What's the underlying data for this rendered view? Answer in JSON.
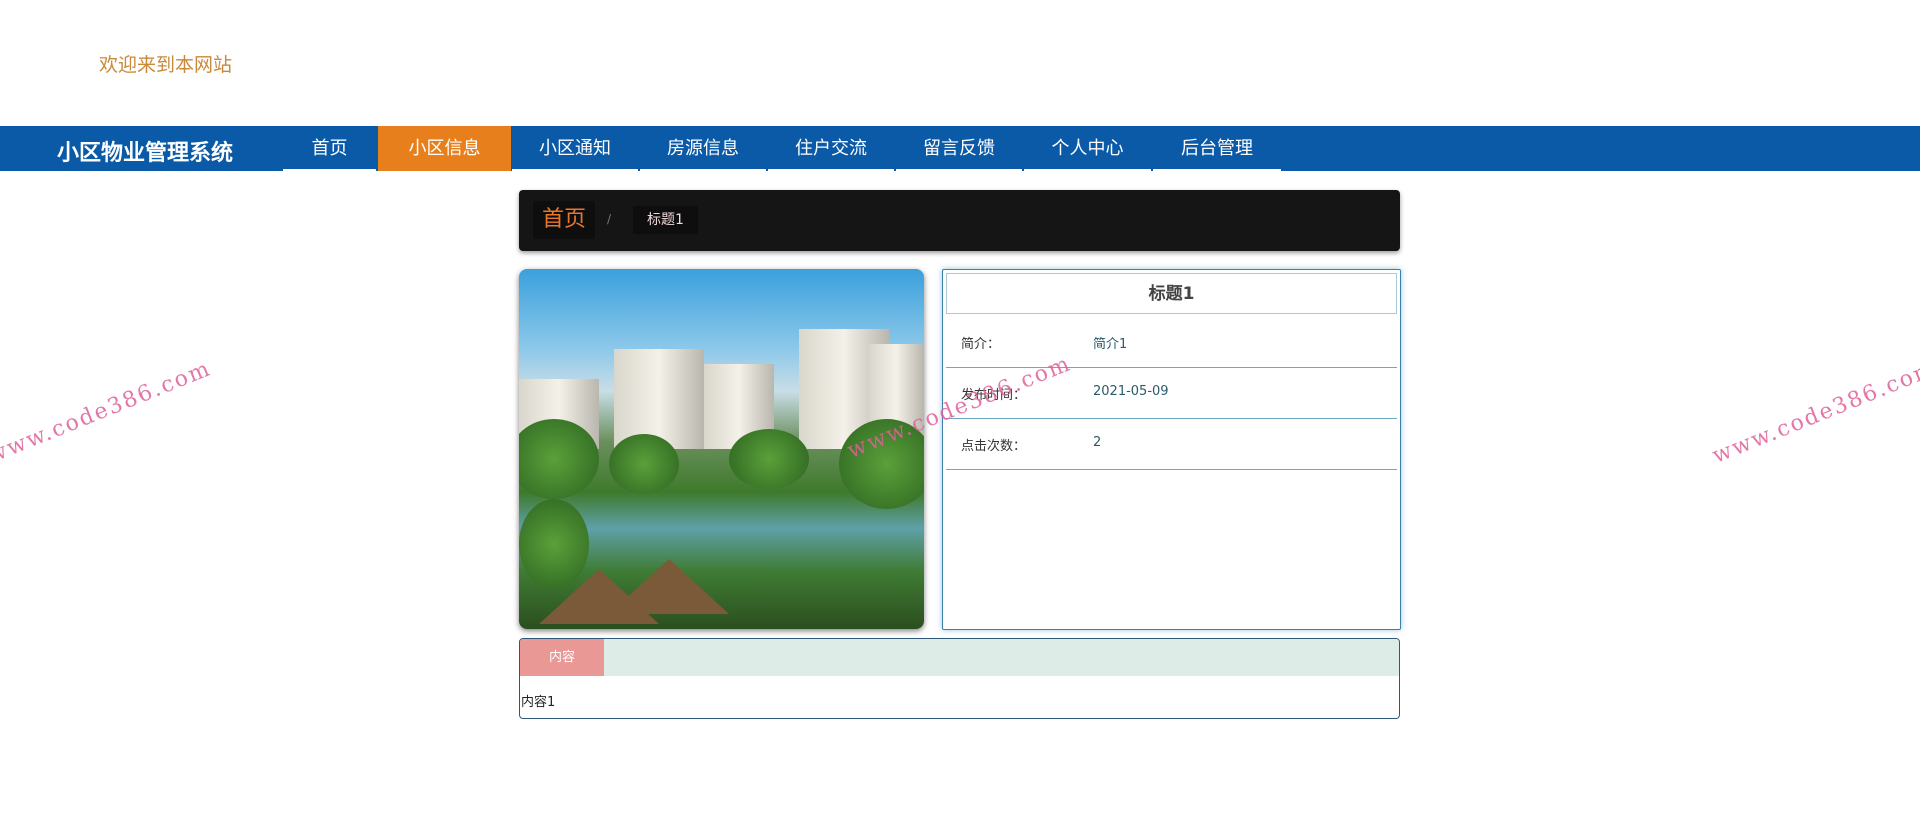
{
  "welcome": "欢迎来到本网站",
  "nav": {
    "brand": "小区物业管理系统",
    "items": [
      "首页",
      "小区信息",
      "小区通知",
      "房源信息",
      "住户交流",
      "留言反馈",
      "个人中心",
      "后台管理"
    ],
    "active": "小区信息"
  },
  "breadcrumb": {
    "home": "首页",
    "separator": "/",
    "current": "标题1"
  },
  "detail": {
    "title": "标题1",
    "fields": [
      {
        "label": "简介：",
        "value": "简介1"
      },
      {
        "label": "发布时间：",
        "value": "2021-05-09"
      },
      {
        "label": "点击次数：",
        "value": "2"
      }
    ]
  },
  "content": {
    "tab": "内容",
    "text": "内容1"
  },
  "watermark": "www.code386.com",
  "colors": {
    "nav": "#0b5aa8",
    "active": "#e7801c",
    "tab": "#e99896"
  }
}
